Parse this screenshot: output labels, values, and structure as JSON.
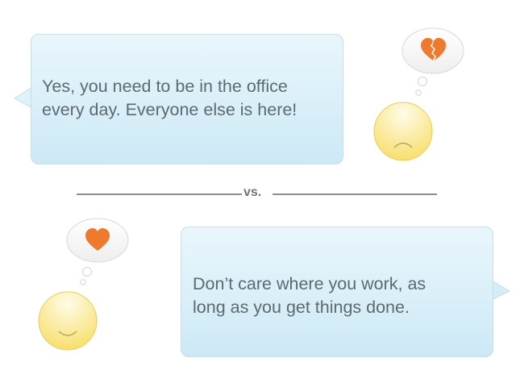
{
  "top_message": {
    "line1": "Yes, you need to be in the office",
    "line2": "every day. Everyone else is here!",
    "thought_icon": "broken-heart-icon",
    "face": "sad-face"
  },
  "divider": {
    "label": "vs."
  },
  "bottom_message": {
    "line1": "Don’t care where you work, as",
    "line2": "long as you get things done.",
    "thought_icon": "heart-icon",
    "face": "happy-face"
  },
  "colors": {
    "bubble": "#d8eef8",
    "heart": "#ee7a2e",
    "face": "#f8e68a",
    "text": "#5d6a6f"
  }
}
